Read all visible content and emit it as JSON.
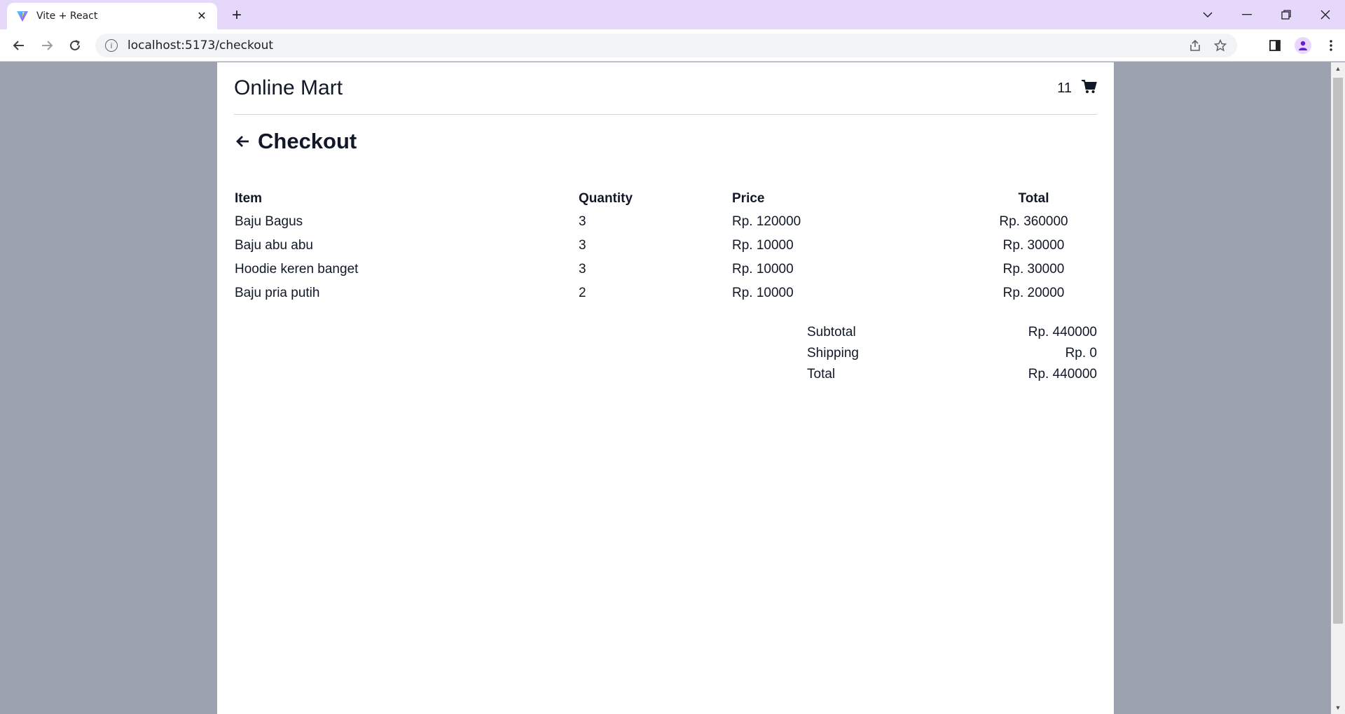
{
  "browser": {
    "tab_title": "Vite + React",
    "url": "localhost:5173/checkout"
  },
  "site": {
    "title": "Online Mart",
    "cart_count": "11"
  },
  "page": {
    "heading": "Checkout"
  },
  "table": {
    "headers": {
      "item": "Item",
      "quantity": "Quantity",
      "price": "Price",
      "total": "Total"
    },
    "rows": [
      {
        "item": "Baju Bagus",
        "quantity": "3",
        "price": "Rp. 120000",
        "total": "Rp. 360000"
      },
      {
        "item": "Baju abu abu",
        "quantity": "3",
        "price": "Rp. 10000",
        "total": "Rp. 30000"
      },
      {
        "item": "Hoodie keren banget",
        "quantity": "3",
        "price": "Rp. 10000",
        "total": "Rp. 30000"
      },
      {
        "item": "Baju pria putih",
        "quantity": "2",
        "price": "Rp. 10000",
        "total": "Rp. 20000"
      }
    ]
  },
  "summary": {
    "subtotal_label": "Subtotal",
    "subtotal_value": "Rp. 440000",
    "shipping_label": "Shipping",
    "shipping_value": "Rp. 0",
    "total_label": "Total",
    "total_value": "Rp. 440000"
  },
  "colors": {
    "tabbar_bg": "#e6d8fb",
    "page_bg": "#9ca3af",
    "content_bg": "#ffffff",
    "text": "#111827"
  },
  "icons": {
    "favicon": "vite-logo-icon",
    "cart": "cart-icon",
    "back": "arrow-left-icon"
  }
}
